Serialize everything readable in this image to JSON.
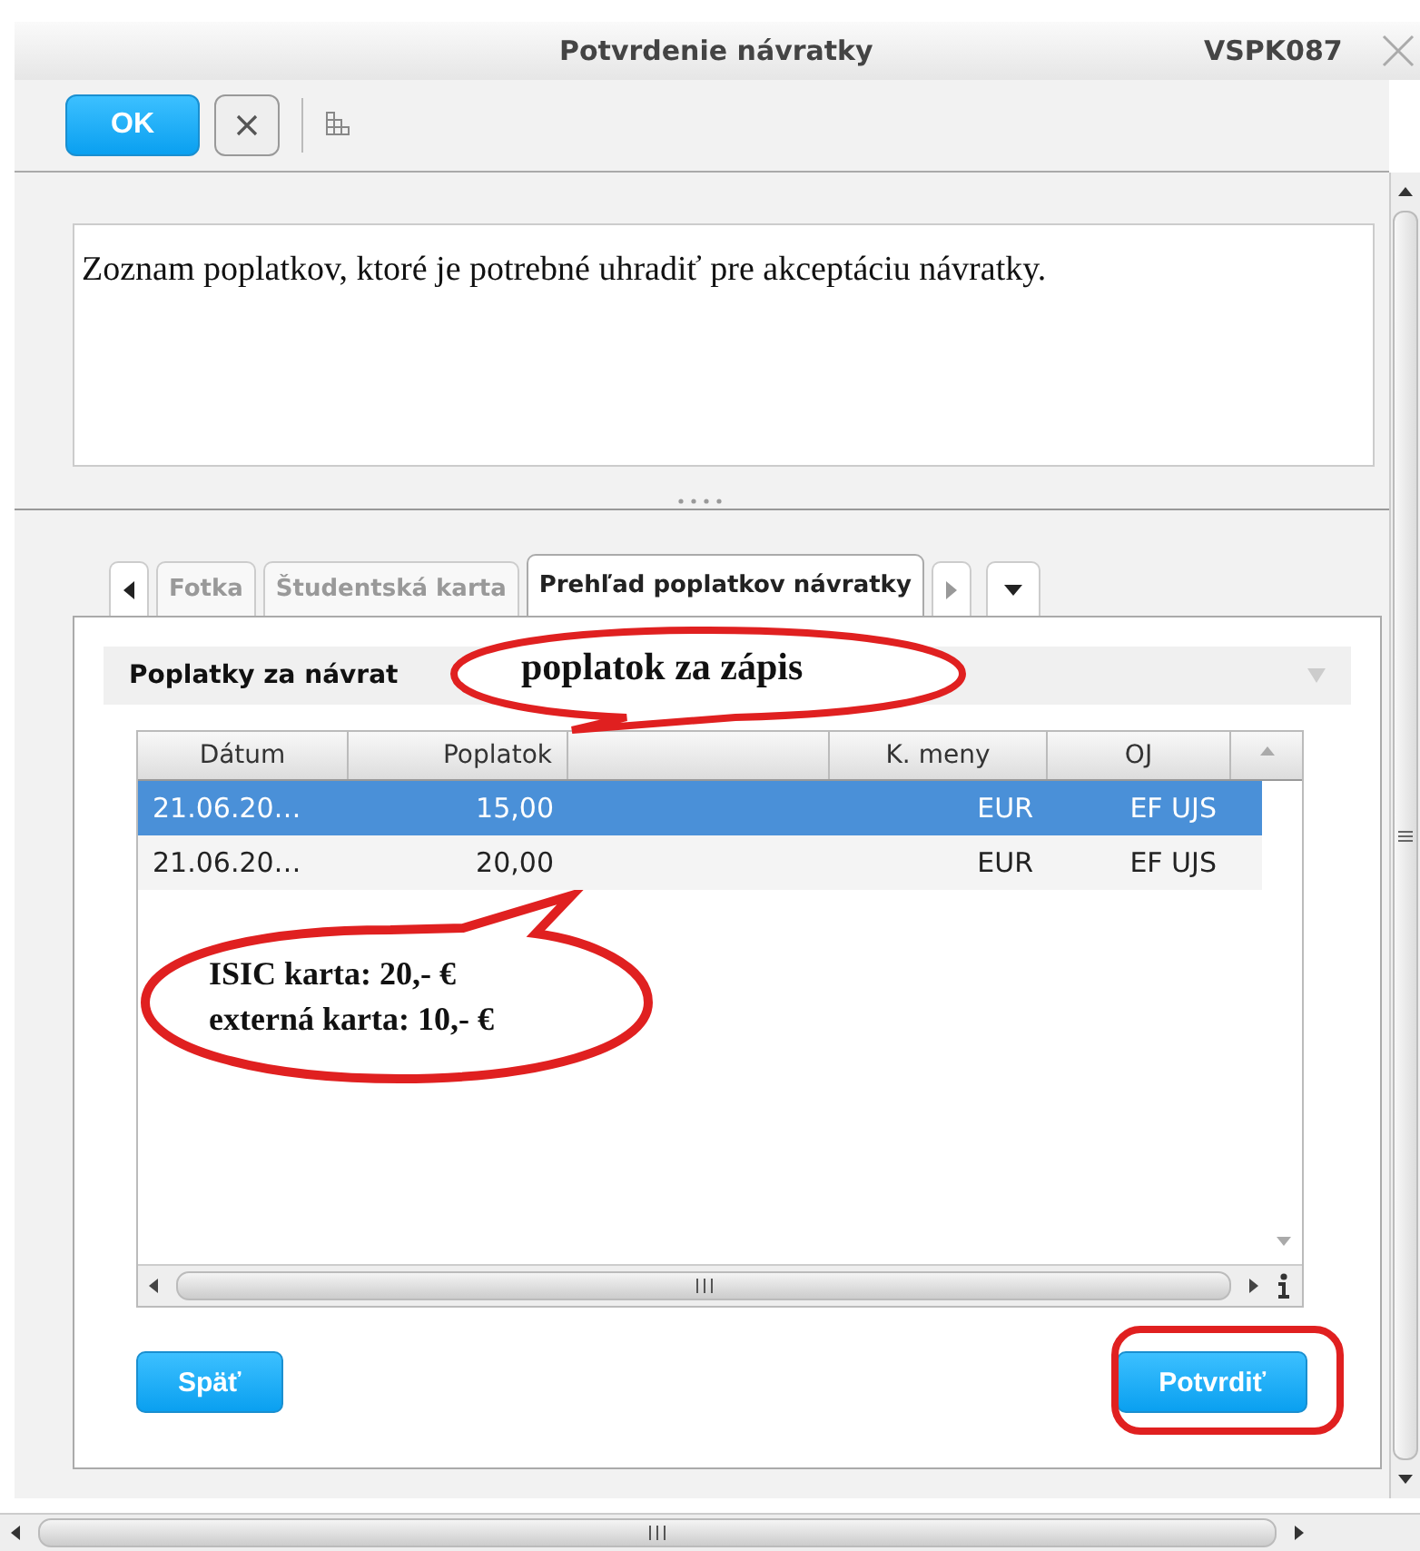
{
  "window": {
    "title": "Potvrdenie návratky",
    "code": "VSPK087"
  },
  "toolbar": {
    "ok": "OK"
  },
  "description": "Zoznam poplatkov, ktoré je potrebné uhradiť pre akceptáciu návratky.",
  "tabs": [
    {
      "label": "Fotka",
      "selected": false
    },
    {
      "label": "Študentská karta",
      "selected": false
    },
    {
      "label": "Prehľad poplatkov návratky",
      "selected": true
    }
  ],
  "section": {
    "title": "Poplatky za návrat"
  },
  "table": {
    "columns": [
      {
        "label": "Dátum"
      },
      {
        "label": "Poplatok"
      },
      {},
      {
        "label": "K. meny"
      },
      {
        "label": "OJ"
      }
    ],
    "rows": [
      {
        "selected": true,
        "cells": [
          "21.06.20…",
          "15,00",
          "",
          "EUR",
          "EF UJS"
        ]
      },
      {
        "selected": false,
        "cells": [
          "21.06.20…",
          "20,00",
          "",
          "EUR",
          "EF UJS"
        ]
      }
    ]
  },
  "buttons": {
    "back": "Späť",
    "confirm": "Potvrdiť"
  },
  "annotations": [
    {
      "kind": "top",
      "lines": [
        "poplatok za zápis"
      ]
    },
    {
      "kind": "bottom",
      "lines": [
        "ISIC karta: 20,- €",
        "externá karta: 10,- €"
      ]
    },
    {
      "kind": "highlight"
    }
  ]
}
